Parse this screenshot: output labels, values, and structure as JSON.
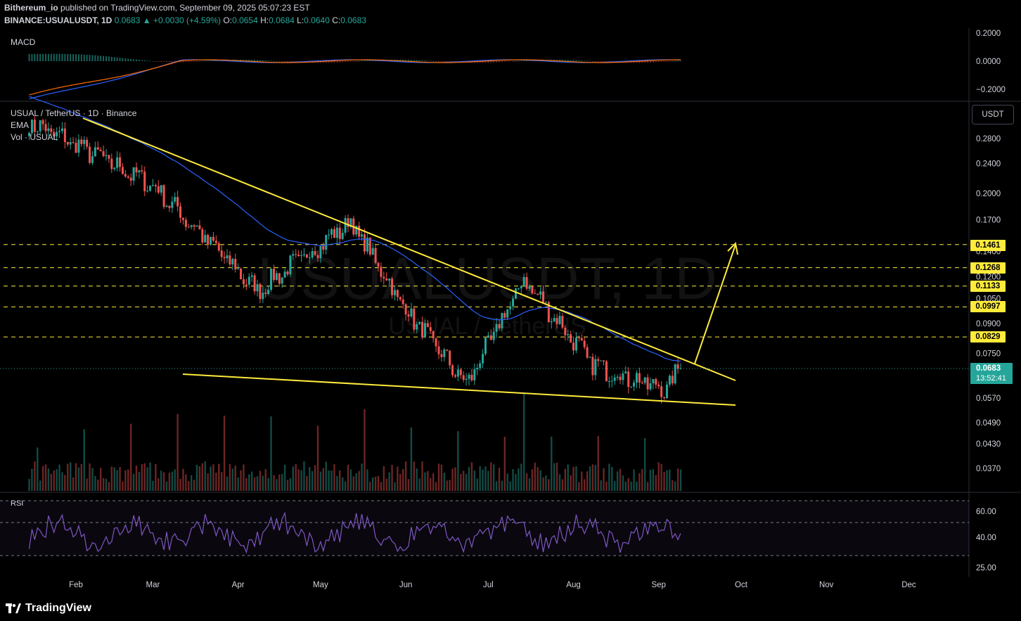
{
  "header": {
    "publisher": "Bithereum_io",
    "published_text": "published on TradingView.com, September 09, 2025 05:07:23 EST",
    "symbol": "BINANCE:USUALUSDT, 1D",
    "last": "0.0683",
    "change": "+0.0030 (+4.59%)",
    "o_label": "O:",
    "o_value": "0.0654",
    "h_label": "H:",
    "h_value": "0.0684",
    "l_label": "L:",
    "l_value": "0.0640",
    "c_label": "C:",
    "c_value": "0.0683"
  },
  "panes": {
    "macd_label": "MACD",
    "main_title": "USUAL / TetherUS · 1D · Binance",
    "ema_label": "EMA",
    "vol_label": "Vol · USUAL",
    "rsi_label": "RSI"
  },
  "watermark": {
    "big": "USUALUSDT, 1D",
    "small": "USUAL / TetherUS"
  },
  "currency_button": "USDT",
  "current_price": {
    "value": "0.0683",
    "countdown": "13:52:41"
  },
  "levels": [
    {
      "label": "0.1461",
      "value": 0.1461
    },
    {
      "label": "0.1268",
      "value": 0.1268
    },
    {
      "label": "0.1133",
      "value": 0.1133
    },
    {
      "label": "0.0997",
      "value": 0.0997
    },
    {
      "label": "0.0829",
      "value": 0.0829
    }
  ],
  "macd_ticks": [
    "0.2000",
    "0.0000",
    "−0.2000"
  ],
  "price_ticks": [
    "0.2800",
    "0.2400",
    "0.2000",
    "0.1700",
    "0.1400",
    "0.1200",
    "0.1050",
    "0.0900",
    "0.0750",
    "0.0570",
    "0.0490",
    "0.0430",
    "0.0370"
  ],
  "rsi_ticks": [
    "60.00",
    "40.00",
    "25.00"
  ],
  "time_ticks": [
    "Feb",
    "Mar",
    "Apr",
    "May",
    "Jun",
    "Jul",
    "Aug",
    "Sep",
    "Oct",
    "Nov",
    "Dec"
  ],
  "brand": "TradingView",
  "colors": {
    "up": "#26a69a",
    "down": "#ef5350",
    "trendline": "#ffeb3b",
    "ema": "#2962ff",
    "macd": "#2962ff",
    "signal": "#ff6d00",
    "rsi": "#7e57c2"
  },
  "chart_data": {
    "type": "candlestick",
    "title": "USUAL / TetherUS · 1D · Binance",
    "y_scale": "log",
    "ylim": [
      0.034,
      0.33
    ],
    "time_range": [
      "2025-01-10",
      "2025-09-09"
    ],
    "key_points": [
      {
        "date": "2025-01-15",
        "price": 0.31
      },
      {
        "date": "2025-02-01",
        "price": 0.27
      },
      {
        "date": "2025-03-01",
        "price": 0.21
      },
      {
        "date": "2025-04-08",
        "price": 0.11
      },
      {
        "date": "2025-05-12",
        "price": 0.168
      },
      {
        "date": "2025-06-01",
        "price": 0.098
      },
      {
        "date": "2025-06-23",
        "price": 0.062
      },
      {
        "date": "2025-07-14",
        "price": 0.118
      },
      {
        "date": "2025-08-08",
        "price": 0.07
      },
      {
        "date": "2025-09-03",
        "price": 0.06
      },
      {
        "date": "2025-09-09",
        "price": 0.0683
      }
    ],
    "trendlines": [
      {
        "name": "upper",
        "from": {
          "date": "2025-02-01",
          "price": 0.3
        },
        "to": {
          "date": "2025-09-30",
          "price": 0.064
        }
      },
      {
        "name": "lower",
        "from": {
          "date": "2025-03-18",
          "price": 0.0645
        },
        "to": {
          "date": "2025-09-30",
          "price": 0.0555
        }
      }
    ],
    "projection": {
      "from": {
        "date": "2025-09-10",
        "price": 0.07
      },
      "to": {
        "date": "2025-09-30",
        "price": 0.1461
      }
    }
  }
}
